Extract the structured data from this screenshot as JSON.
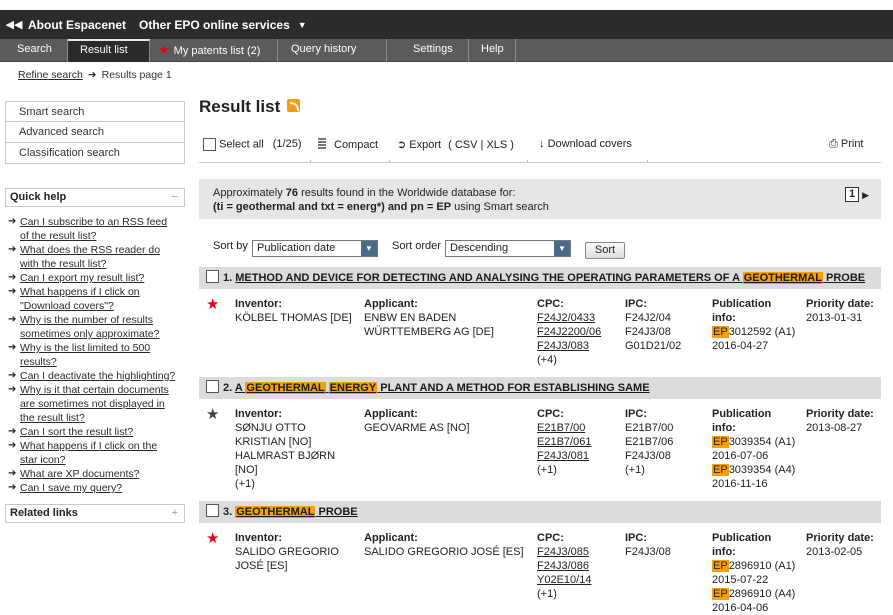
{
  "topbar": {
    "items": [
      "About Espacenet",
      "Other EPO online services"
    ]
  },
  "nav": {
    "tabs": [
      "Search",
      "Result list",
      "My patents list (2)",
      "Query history",
      "Settings",
      "Help"
    ]
  },
  "breadcrumb": {
    "link": "Refine search",
    "current": "Results page 1"
  },
  "sidebar": {
    "links": [
      "Smart search",
      "Advanced search",
      "Classification search"
    ],
    "quick_help_title": "Quick help",
    "quick_help_toggle": "−",
    "quick_help": [
      [
        "Can I subscribe to an RSS feed",
        "of the result list?"
      ],
      [
        "What does the RSS reader do",
        "with the result list?"
      ],
      [
        "Can I export my result list?"
      ],
      [
        "What happens if I click on",
        "\"Download covers\"?"
      ],
      [
        "Why is the number of results",
        "sometimes only approximate?"
      ],
      [
        "Why is the list limited to 500",
        "results?"
      ],
      [
        "Can I deactivate the highlighting?"
      ],
      [
        "Why is it that certain documents",
        "are sometimes not displayed in",
        "the result list?"
      ],
      [
        "Can I sort the result list?"
      ],
      [
        "What happens if I click on the",
        "star icon?"
      ],
      [
        "What are XP documents?"
      ],
      [
        "Can I save my query?"
      ]
    ],
    "related_links_title": "Related links",
    "related_links_toggle": "+"
  },
  "main": {
    "title": "Result list",
    "toolbar": {
      "select_all": "Select all",
      "count": "(1/25)",
      "compact": "Compact",
      "export": "Export",
      "export_formats": "( CSV | XLS )",
      "download_covers": "Download covers",
      "print": "Print"
    },
    "info": {
      "line1_pre": "Approximately ",
      "count": "76",
      "line1_post": " results found in the Worldwide database for:",
      "query": "(ti = geothermal and txt = energ*) and pn = EP",
      "query_post": " using Smart search",
      "page": "1"
    },
    "sort": {
      "sort_by_label": "Sort by",
      "sort_by_value": "Publication date",
      "order_label": "Sort order",
      "order_value": "Descending",
      "button": "Sort"
    }
  },
  "labels": {
    "inventor": "Inventor:",
    "applicant": "Applicant:",
    "cpc": "CPC:",
    "ipc": "IPC:",
    "pub1": "Publication",
    "pub2": "info:",
    "priority": "Priority date:"
  },
  "results": [
    {
      "num": "1.",
      "title_parts": [
        [
          "METHOD AND DEVICE FOR DETECTING AND ANALYSING THE OPERATING PARAMETERS OF A ",
          false
        ],
        [
          "GEOTHERMAL",
          true
        ],
        [
          " PROBE",
          false
        ]
      ],
      "star_color": "#e3001b",
      "inventor": [
        "KÖLBEL THOMAS  [DE]"
      ],
      "applicant": [
        "ENBW EN BADEN",
        "WÜRTTEMBERG AG  [DE]"
      ],
      "cpc": [
        "F24J2/0433",
        "F24J2200/06",
        "F24J3/083"
      ],
      "cpc_more": "(+4)",
      "ipc": [
        "F24J2/04",
        "F24J3/08",
        "G01D21/02"
      ],
      "ipc_more": "",
      "pubs": [
        {
          "ep": "EP",
          "num": "3012592 (A1)",
          "date": "2016-04-27"
        }
      ],
      "priority": "2013-01-31"
    },
    {
      "num": "2.",
      "title_parts": [
        [
          "A ",
          false
        ],
        [
          "GEOTHERMAL",
          true
        ],
        [
          " ",
          false
        ],
        [
          "ENERGY",
          true
        ],
        [
          " PLANT AND A METHOD FOR ESTABLISHING SAME",
          false
        ]
      ],
      "star_color": "#444444",
      "inventor": [
        "SØNJU OTTO",
        "KRISTIAN  [NO]",
        "HALMRAST BJØRN",
        "[NO]",
        "(+1)"
      ],
      "applicant": [
        "GEOVARME AS  [NO]"
      ],
      "cpc": [
        "E21B7/00",
        "E21B7/061",
        "F24J3/081"
      ],
      "cpc_more": "(+1)",
      "ipc": [
        "E21B7/00",
        "E21B7/06",
        "F24J3/08"
      ],
      "ipc_more": "(+1)",
      "pubs": [
        {
          "ep": "EP",
          "num": "3039354 (A1)",
          "date": "2016-07-06"
        },
        {
          "ep": "EP",
          "num": "3039354 (A4)",
          "date": "2016-11-16"
        }
      ],
      "priority": "2013-08-27"
    },
    {
      "num": "3.",
      "title_parts": [
        [
          "GEOTHERMAL",
          true
        ],
        [
          " PROBE",
          false
        ]
      ],
      "star_color": "#e3001b",
      "inventor": [
        "SALIDO GREGORIO",
        "JOSÉ  [ES]"
      ],
      "applicant": [
        "SALIDO GREGORIO JOSÉ  [ES]"
      ],
      "cpc": [
        "F24J3/085",
        "F24J3/086",
        "Y02E10/14"
      ],
      "cpc_more": "(+1)",
      "ipc": [
        "F24J3/08"
      ],
      "ipc_more": "",
      "pubs": [
        {
          "ep": "EP",
          "num": "2896910 (A1)",
          "date": "2015-07-22"
        },
        {
          "ep": "EP",
          "num": "2896910 (A4)",
          "date": "2016-04-06"
        }
      ],
      "priority": "2013-02-05"
    }
  ]
}
